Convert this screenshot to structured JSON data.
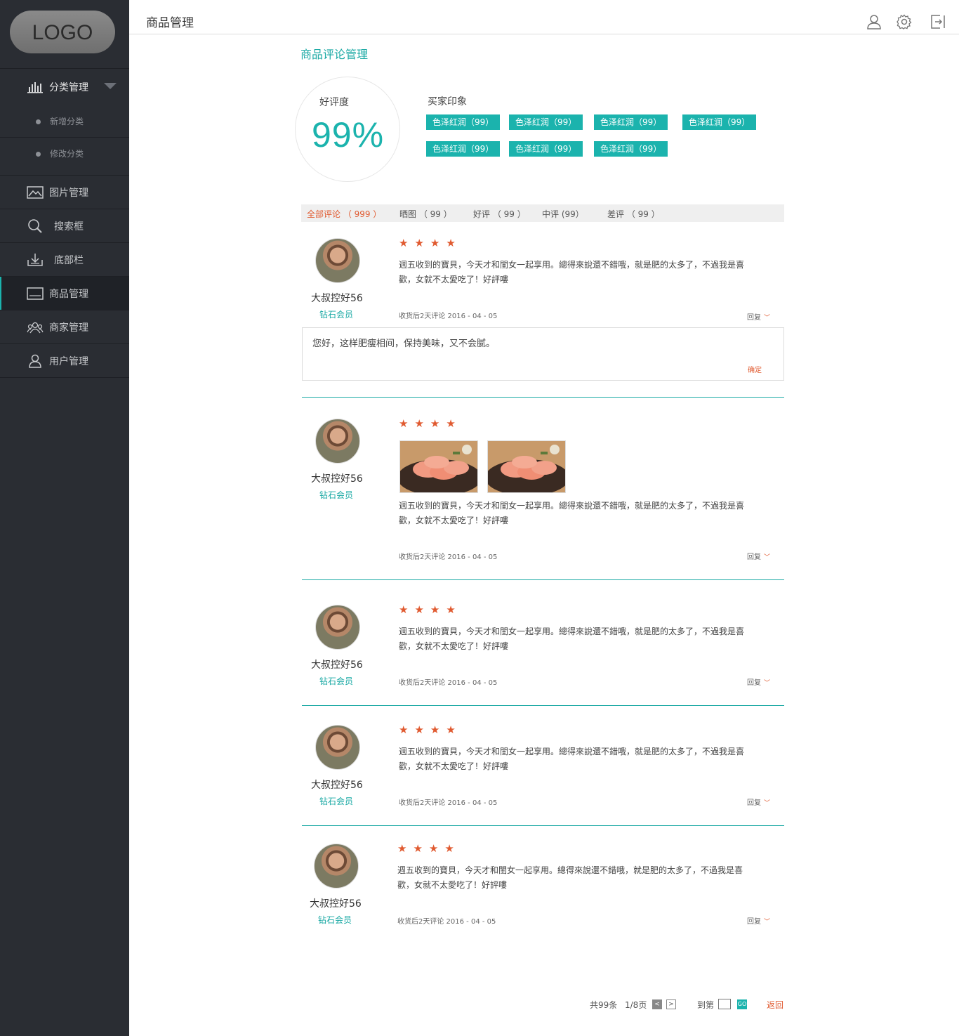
{
  "sidebar": {
    "logo": "LOGO",
    "category": {
      "label": "分类管理",
      "sub": [
        "新增分类",
        "修改分类"
      ]
    },
    "items": [
      {
        "label": "图片管理",
        "icon": "image-icon"
      },
      {
        "label": "搜索框",
        "icon": "search-icon"
      },
      {
        "label": "底部栏",
        "icon": "download-icon"
      },
      {
        "label": "商品管理",
        "icon": "screen-icon"
      },
      {
        "label": "商家管理",
        "icon": "group-icon"
      },
      {
        "label": "用户管理",
        "icon": "user-icon"
      }
    ]
  },
  "header": {
    "title": "商品管理",
    "icons": [
      "user-icon",
      "gear-icon",
      "logout-icon"
    ]
  },
  "section": {
    "title": "商品评论管理",
    "rating_label": "好评度",
    "rating_value": "99%",
    "impression_label": "买家印象",
    "tags": [
      "色泽红润（99）",
      "色泽红润（99）",
      "色泽红润（99）",
      "色泽红润（99）",
      "色泽红润（99）",
      "色泽红润（99）",
      "色泽红润（99）"
    ]
  },
  "tabs": [
    "全部评论 （ 999 ）",
    "晒图 （ 99 ）",
    "好评 （ 99 ）",
    "中评 (99）",
    "差评 （ 99 ）"
  ],
  "reviews": [
    {
      "name": "大叔控好56",
      "level": "钻石会员",
      "stars": "★★★★",
      "text": "週五收到的寶貝，今天才和閨女一起享用。總得來說還不錯哦，就是肥的太多了，不過我是喜歡，女就不太愛吃了！好評嘍",
      "meta": "收货后2天评论  2016 - 04 - 05",
      "reply_label": "回复",
      "reply_text": "您好，这样肥瘦相间，保持美味，又不会腻。",
      "reply_ok": "确定"
    },
    {
      "name": "大叔控好56",
      "level": "钻石会员",
      "stars": "★★★★",
      "text": "週五收到的寶貝，今天才和閨女一起享用。總得來說還不錯哦，就是肥的太多了，不過我是喜歡，女就不太愛吃了！好評嘍",
      "meta": "收货后2天评论  2016 - 04 - 05",
      "reply_label": "回复"
    },
    {
      "name": "大叔控好56",
      "level": "钻石会员",
      "stars": "★★★★",
      "text": "週五收到的寶貝，今天才和閨女一起享用。總得來說還不錯哦，就是肥的太多了，不過我是喜歡，女就不太愛吃了！好評嘍",
      "meta": "收货后2天评论  2016 - 04 - 05",
      "reply_label": "回复"
    },
    {
      "name": "大叔控好56",
      "level": "钻石会员",
      "stars": "★★★★",
      "text": "週五收到的寶貝，今天才和閨女一起享用。總得來說還不錯哦，就是肥的太多了，不過我是喜歡，女就不太愛吃了！好評嘍",
      "meta": "收货后2天评论  2016 - 04 - 05",
      "reply_label": "回复"
    },
    {
      "name": "大叔控好56",
      "level": "钻石会员",
      "stars": "★★★★",
      "text": "週五收到的寶貝，今天才和閨女一起享用。總得來說還不錯哦，就是肥的太多了，不過我是喜歡，女就不太愛吃了！好評嘍",
      "meta": "收货后2天评论  2016 - 04 - 05",
      "reply_label": "回复"
    }
  ],
  "pager": {
    "total": "共99条",
    "page": "1/8页",
    "goto": "到第",
    "go": "GO",
    "back": "返回"
  },
  "colors": {
    "accent": "#1bb3ad",
    "highlight": "#e05a30",
    "sidebar_bg": "#2a2d33"
  }
}
